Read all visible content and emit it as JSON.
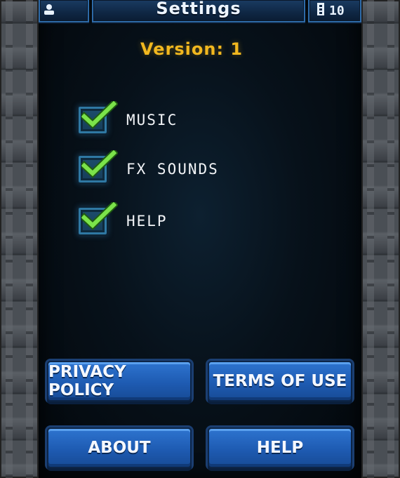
{
  "header": {
    "title": "Settings",
    "score": "10",
    "user_icon": "user-icon",
    "score_icon": "tower-icon"
  },
  "version_text": "Version: 1",
  "options": [
    {
      "label": "MUSIC",
      "checked": true
    },
    {
      "label": "FX SOUNDS",
      "checked": true
    },
    {
      "label": "HELP",
      "checked": true
    }
  ],
  "buttons": {
    "privacy": "PRIVACY POLICY",
    "terms": "TERMS OF USE",
    "about": "ABOUT",
    "help": "HELP"
  },
  "colors": {
    "accent_yellow": "#f2b81f",
    "check_green": "#7be34a",
    "button_blue": "#2e74cf"
  }
}
